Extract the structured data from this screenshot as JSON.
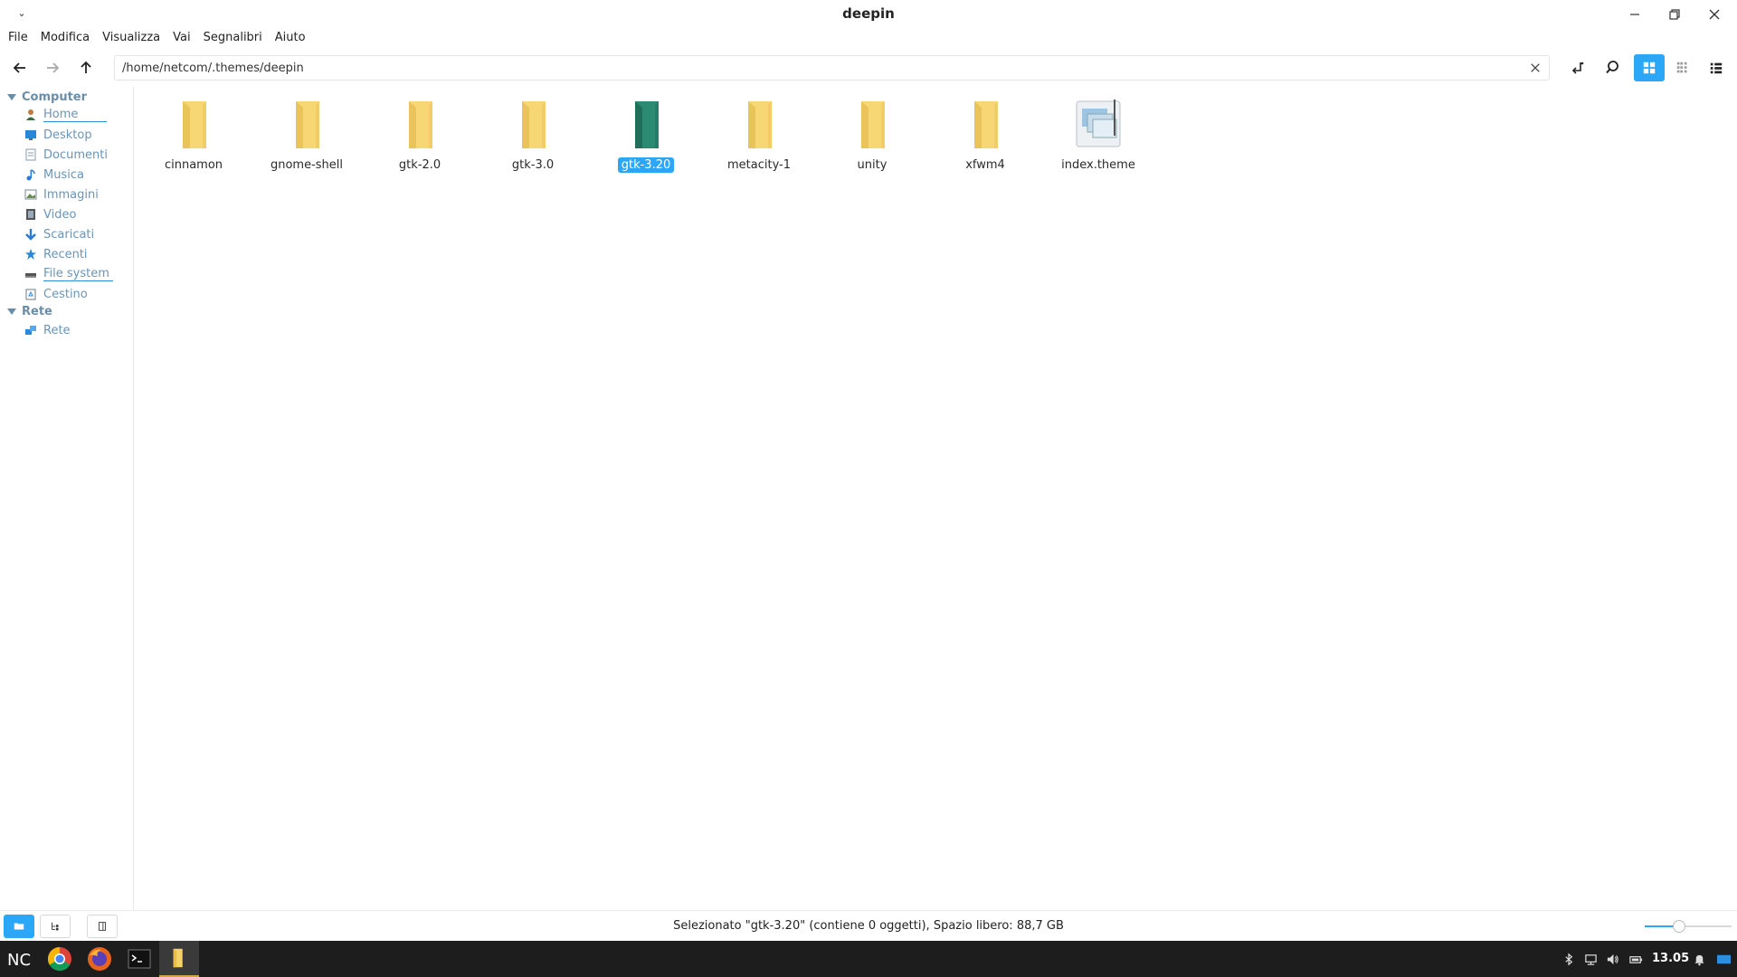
{
  "window": {
    "title": "deepin"
  },
  "menubar": {
    "items": [
      "File",
      "Modifica",
      "Visualizza",
      "Vai",
      "Segnalibri",
      "Aiuto"
    ]
  },
  "toolbar": {
    "address_value": "/home/netcom/.themes/deepin",
    "active_view": "icon-view"
  },
  "sidebar": {
    "sections": [
      {
        "label": "Computer",
        "items": [
          {
            "label": "Home",
            "icon": "home-icon",
            "mounted": true
          },
          {
            "label": "Desktop",
            "icon": "desktop-icon",
            "mounted": false
          },
          {
            "label": "Documenti",
            "icon": "documents-icon",
            "mounted": false
          },
          {
            "label": "Musica",
            "icon": "music-icon",
            "mounted": false
          },
          {
            "label": "Immagini",
            "icon": "pictures-icon",
            "mounted": false
          },
          {
            "label": "Video",
            "icon": "video-icon",
            "mounted": false
          },
          {
            "label": "Scaricati",
            "icon": "downloads-icon",
            "mounted": false
          },
          {
            "label": "Recenti",
            "icon": "recent-icon",
            "mounted": false
          },
          {
            "label": "File system",
            "icon": "drive-icon",
            "mounted": true
          },
          {
            "label": "Cestino",
            "icon": "trash-icon",
            "mounted": false
          }
        ]
      },
      {
        "label": "Rete",
        "items": [
          {
            "label": "Rete",
            "icon": "network-icon",
            "mounted": false
          }
        ]
      }
    ]
  },
  "files": [
    {
      "name": "cinnamon",
      "type": "folder",
      "selected": false
    },
    {
      "name": "gnome-shell",
      "type": "folder",
      "selected": false
    },
    {
      "name": "gtk-2.0",
      "type": "folder",
      "selected": false
    },
    {
      "name": "gtk-3.0",
      "type": "folder",
      "selected": false
    },
    {
      "name": "gtk-3.20",
      "type": "folder",
      "selected": true
    },
    {
      "name": "metacity-1",
      "type": "folder",
      "selected": false
    },
    {
      "name": "unity",
      "type": "folder",
      "selected": false
    },
    {
      "name": "xfwm4",
      "type": "folder",
      "selected": false
    },
    {
      "name": "index.theme",
      "type": "theme-file",
      "selected": false
    }
  ],
  "statusbar": {
    "text": "Selezionato \"gtk-3.20\" (contiene 0 oggetti), Spazio libero: 88,7 GB",
    "zoom_level": 0.4
  },
  "taskbar": {
    "clock": "13.05"
  },
  "colors": {
    "accent": "#2ca7f8",
    "folder": "#f7d774",
    "folder_selected": "#2a8a72",
    "taskbar": "#1d1d1d"
  }
}
